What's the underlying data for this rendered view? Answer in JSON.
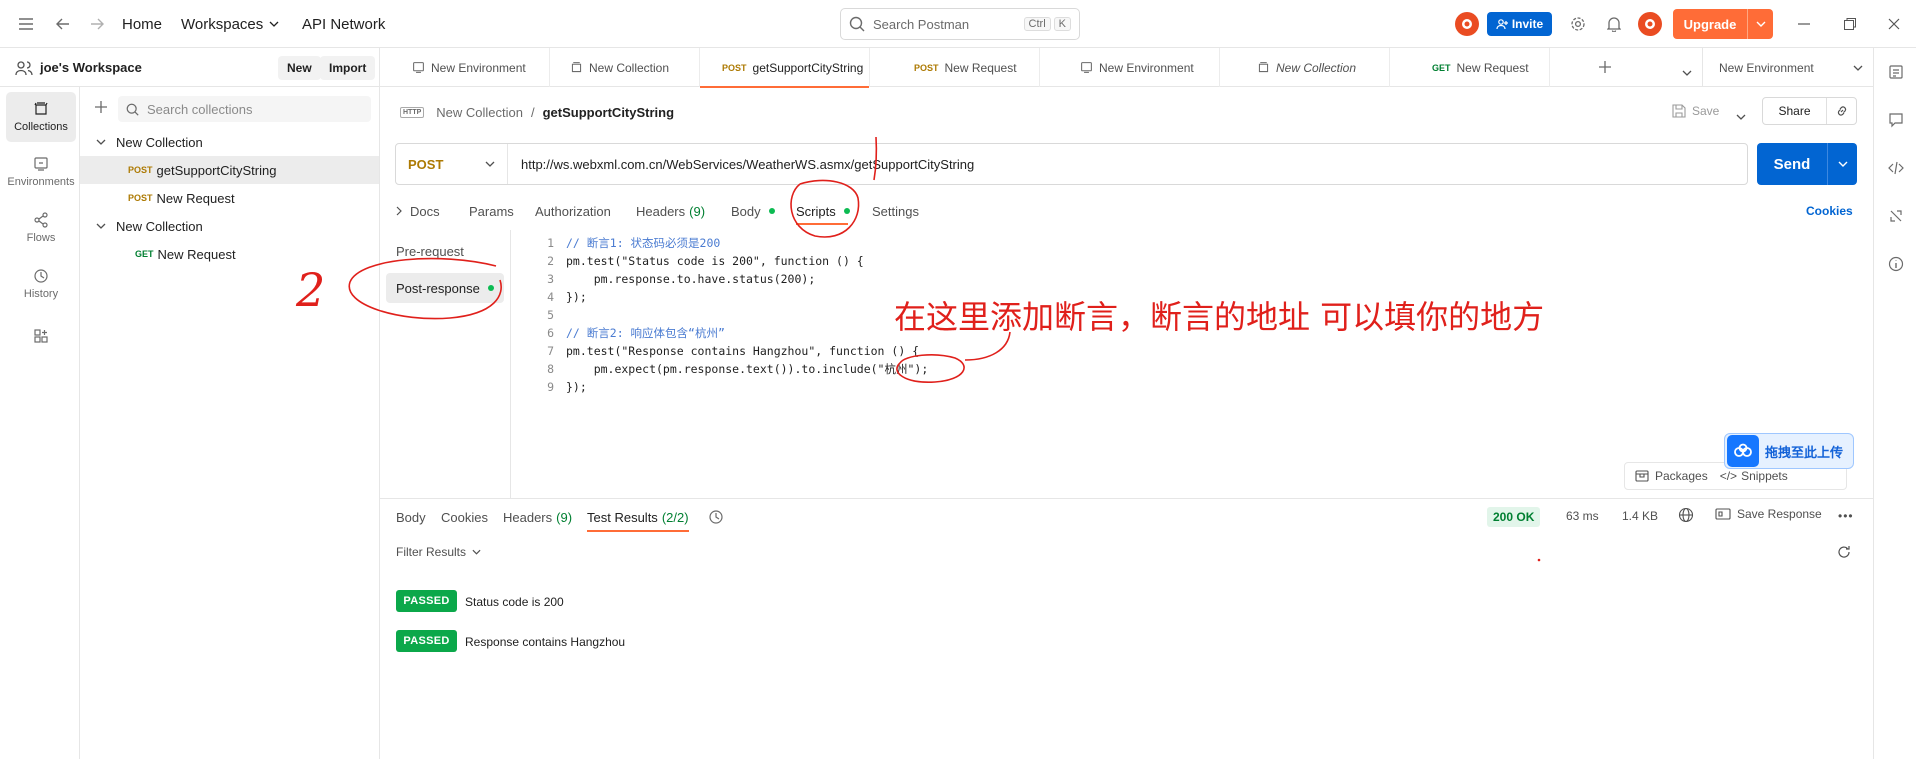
{
  "topbar": {
    "home": "Home",
    "workspaces": "Workspaces",
    "api_network": "API Network",
    "search_placeholder": "Search Postman",
    "kbd_ctrl": "Ctrl",
    "kbd_k": "K",
    "invite": "Invite",
    "upgrade": "Upgrade"
  },
  "workspace": {
    "name": "joe's Workspace",
    "new_btn": "New",
    "import_btn": "Import"
  },
  "rail": {
    "items": [
      {
        "label": "Collections",
        "icon": "collections-icon"
      },
      {
        "label": "Environments",
        "icon": "environments-icon"
      },
      {
        "label": "Flows",
        "icon": "flows-icon"
      },
      {
        "label": "History",
        "icon": "history-icon"
      }
    ]
  },
  "sidebar": {
    "search_placeholder": "Search collections",
    "tree": [
      {
        "type": "collection",
        "label": "New Collection"
      },
      {
        "type": "request",
        "method": "POST",
        "label": "getSupportCityString",
        "selected": true
      },
      {
        "type": "request",
        "method": "POST",
        "label": "New Request"
      },
      {
        "type": "collection",
        "label": "New Collection"
      },
      {
        "type": "request",
        "method": "GET",
        "label": "New Request"
      }
    ]
  },
  "tabs": [
    {
      "kind": "env",
      "label": "New Environment"
    },
    {
      "kind": "collection",
      "label": "New Collection"
    },
    {
      "kind": "request",
      "method": "POST",
      "label": "getSupportCityString",
      "active": true
    },
    {
      "kind": "request",
      "method": "POST",
      "label": "New Request"
    },
    {
      "kind": "env",
      "label": "New Environment"
    },
    {
      "kind": "collection",
      "label": "New Collection",
      "italic": true
    },
    {
      "kind": "request",
      "method": "GET",
      "label": "New Request"
    }
  ],
  "env_selector": "New Environment",
  "request": {
    "breadcrumb_parent": "New Collection",
    "breadcrumb_sep": "/",
    "breadcrumb_name": "getSupportCityString",
    "badge": "HTTP",
    "save": "Save",
    "share": "Share",
    "method": "POST",
    "url": "http://ws.webxml.com.cn/WebServices/WeatherWS.asmx/getSupportCityString",
    "send": "Send",
    "cookies": "Cookies",
    "tabs": {
      "docs": "Docs",
      "params": "Params",
      "authorization": "Authorization",
      "headers": "Headers",
      "headers_count": "(9)",
      "body": "Body",
      "scripts": "Scripts",
      "settings": "Settings"
    }
  },
  "scripts": {
    "pre_request": "Pre-request",
    "post_response": "Post-response",
    "code_lines": [
      "// 断言1: 状态码必须是200",
      "pm.test(\"Status code is 200\", function () {",
      "    pm.response.to.have.status(200);",
      "});",
      "",
      "// 断言2: 响应体包含“杭州”",
      "pm.test(\"Response contains Hangzhou\", function () {",
      "    pm.expect(pm.response.text()).to.include(\"杭州\");",
      "});"
    ],
    "packages": "Packages",
    "snippets": "Snippets"
  },
  "upload_float": "拖拽至此上传",
  "response": {
    "tabs": {
      "body": "Body",
      "cookies": "Cookies",
      "headers": "Headers",
      "headers_count": "(9)",
      "test_results": "Test Results",
      "test_results_count": "(2/2)"
    },
    "status": "200 OK",
    "time": "63 ms",
    "size": "1.4 KB",
    "save_response": "Save Response",
    "filter": "Filter Results",
    "results": [
      {
        "status": "PASSED",
        "name": "Status code is 200"
      },
      {
        "status": "PASSED",
        "name": "Response contains Hangzhou"
      }
    ]
  },
  "annotation": {
    "text": "在这里添加断言，断言的地址 可以填你的地方",
    "number": "2"
  },
  "colors": {
    "accent": "#ff6c37",
    "primary": "#0265d2",
    "post": "#ad7a03",
    "get": "#007f31",
    "passed": "#0ba84a",
    "annotation": "#e0201b"
  }
}
